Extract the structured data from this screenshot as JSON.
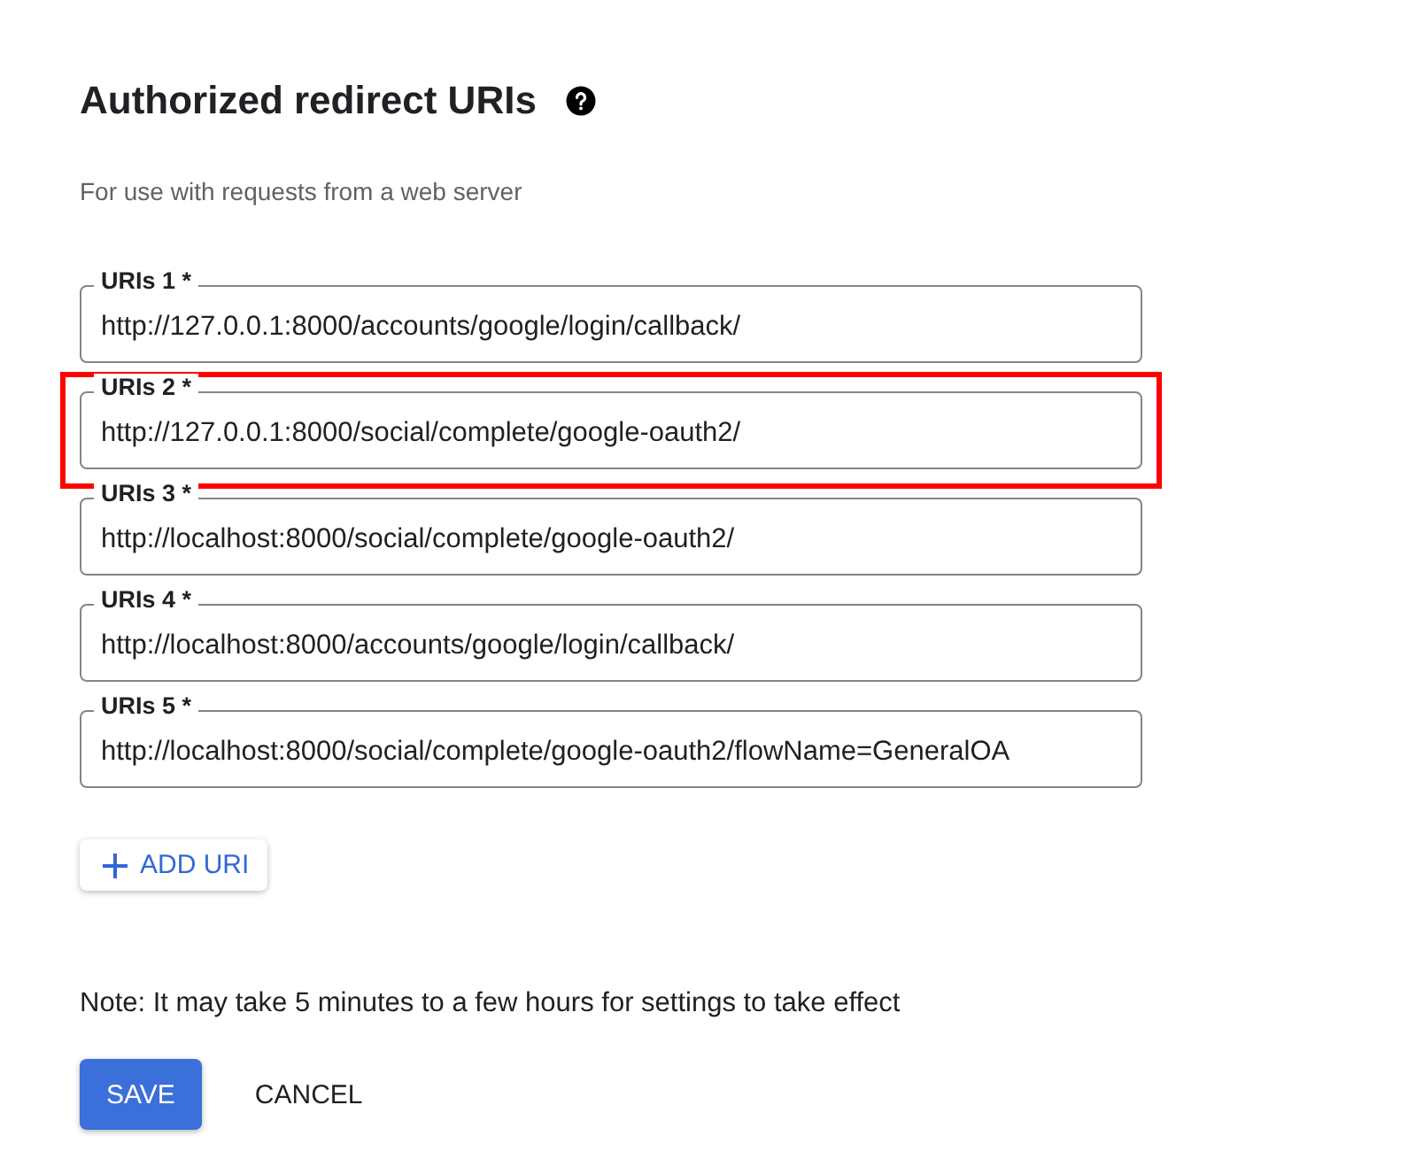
{
  "title": "Authorized redirect URIs",
  "subtitle": "For use with requests from a web server",
  "uris": [
    {
      "label": "URIs 1 *",
      "value": "http://127.0.0.1:8000/accounts/google/login/callback/",
      "highlighted": false
    },
    {
      "label": "URIs 2 *",
      "value": "http://127.0.0.1:8000/social/complete/google-oauth2/",
      "highlighted": true
    },
    {
      "label": "URIs 3 *",
      "value": "http://localhost:8000/social/complete/google-oauth2/",
      "highlighted": false
    },
    {
      "label": "URIs 4 *",
      "value": "http://localhost:8000/accounts/google/login/callback/",
      "highlighted": false
    },
    {
      "label": "URIs 5 *",
      "value": "http://localhost:8000/social/complete/google-oauth2/flowName=GeneralOA",
      "highlighted": false
    }
  ],
  "add_button": "ADD URI",
  "note": "Note: It may take 5 minutes to a few hours for settings to take effect",
  "buttons": [
    {
      "label": "SAVE",
      "kind": "primary"
    },
    {
      "label": "CANCEL",
      "kind": "text"
    }
  ]
}
